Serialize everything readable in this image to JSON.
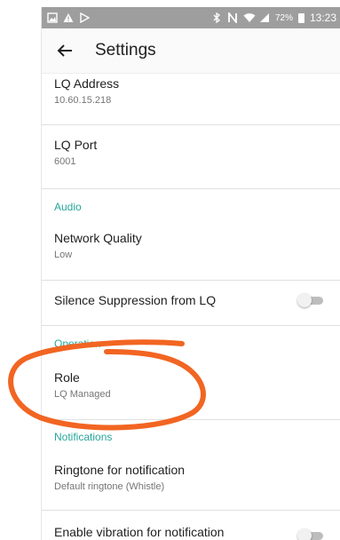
{
  "status_bar": {
    "battery": "72%",
    "time": "13:23",
    "icons": [
      "image-icon",
      "warning-icon",
      "play-store-icon",
      "bluetooth-icon",
      "nfc-icon",
      "wifi-icon",
      "signal-icon",
      "battery-icon"
    ]
  },
  "toolbar": {
    "title": "Settings",
    "back_icon": "arrow-left-icon"
  },
  "preferences": {
    "lq_address": {
      "title": "LQ Address",
      "value": "10.60.15.218"
    },
    "lq_port": {
      "title": "LQ Port",
      "value": "6001"
    },
    "audio_header": "Audio",
    "network_quality": {
      "title": "Network Quality",
      "value": "Low"
    },
    "silence_suppression": {
      "title": "Silence Suppression from LQ",
      "enabled": false
    },
    "operation_header": "Operation",
    "role": {
      "title": "Role",
      "value": "LQ Managed"
    },
    "notifications_header": "Notifications",
    "ringtone": {
      "title": "Ringtone for notification",
      "value": "Default ringtone (Whistle)"
    },
    "vibration": {
      "title": "Enable vibration for notification",
      "enabled": false
    }
  },
  "colors": {
    "accent": "#26a69a",
    "annotation": "#f26522",
    "status_bar": "#9e9e9e"
  }
}
